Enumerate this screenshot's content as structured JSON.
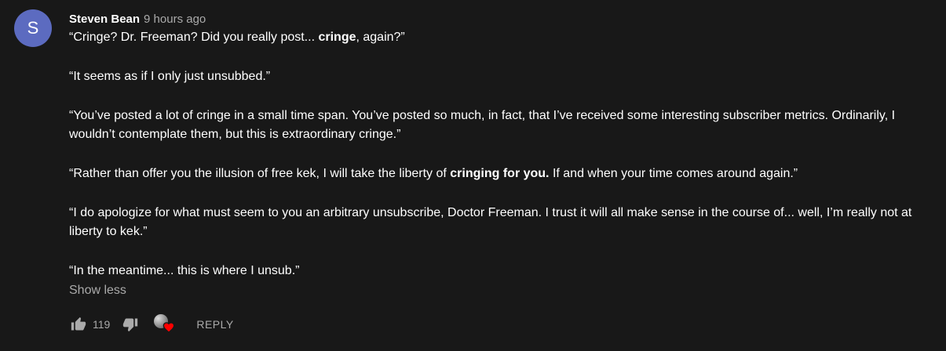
{
  "comment": {
    "avatar_letter": "S",
    "avatar_color": "#5c6bc0",
    "author": "Steven Bean",
    "time": "9 hours ago",
    "paragraphs": [
      [
        {
          "text": "“Cringe? Dr. Freeman? Did you really post... "
        },
        {
          "text": "cringe",
          "bold": true
        },
        {
          "text": ", again?”"
        }
      ],
      [
        {
          "text": "“It seems as if I only just unsubbed.”"
        }
      ],
      [
        {
          "text": "“You’ve posted a lot of cringe in a small time span. You’ve posted so much, in fact, that I’ve received some interesting subscriber metrics. Ordinarily, I wouldn’t contemplate them, but this is extraordinary cringe.”"
        }
      ],
      [
        {
          "text": "“Rather than offer you the illusion of free kek, I will take the liberty of "
        },
        {
          "text": "cringing for you.",
          "bold": true
        },
        {
          "text": " If and when your time comes around again.”"
        }
      ],
      [
        {
          "text": "“I do apologize for what must seem to you an arbitrary unsubscribe, Doctor Freeman. I trust it will all make sense in the course of... well, I’m really not at liberty to kek.”"
        }
      ],
      [
        {
          "text": "“In the meantime... this is where I unsub.”"
        }
      ]
    ],
    "show_less_label": "Show less",
    "like_count": "119",
    "reply_label": "REPLY",
    "icons": {
      "like": "thumbs-up-icon",
      "dislike": "thumbs-down-icon",
      "creator_heart": "creator-heart-icon"
    },
    "heart_color": "#ff0000"
  }
}
